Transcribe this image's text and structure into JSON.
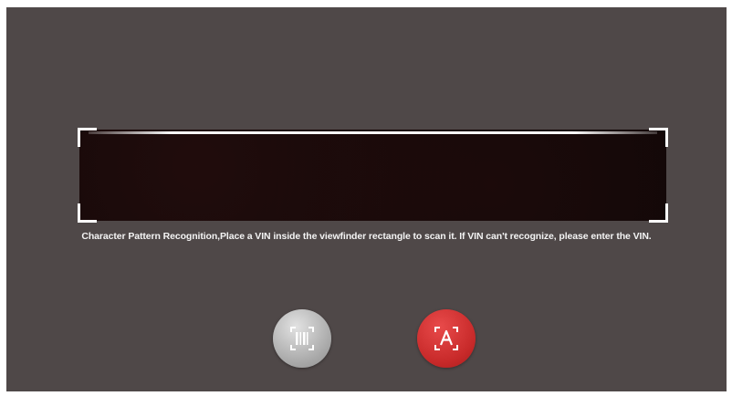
{
  "scanner": {
    "hint_text": "Character Pattern Recognition,Place a VIN inside the viewfinder rectangle to scan it. If VIN can't recognize, please enter the VIN."
  },
  "buttons": [
    {
      "icon": "barcode-scan-icon",
      "color": "#a6a6a6"
    },
    {
      "icon": "text-recognition-icon",
      "color": "#c82a2a"
    }
  ],
  "colors": {
    "background": "#4f4848",
    "viewfinder": "#120808",
    "hint_text": "#f4f4f4"
  }
}
